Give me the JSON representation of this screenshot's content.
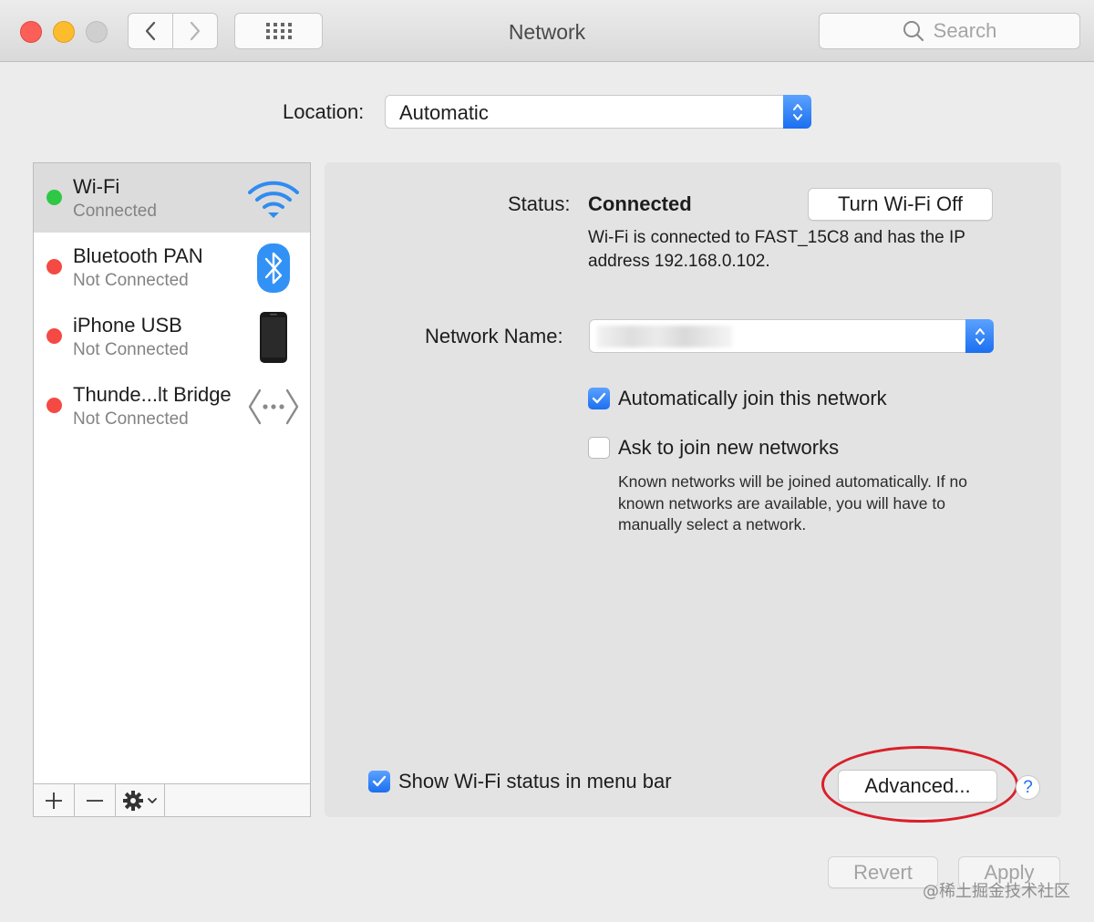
{
  "window": {
    "title": "Network",
    "search_placeholder": "Search"
  },
  "location": {
    "label": "Location:",
    "value": "Automatic"
  },
  "services": [
    {
      "name": "Wi-Fi",
      "status": "Connected",
      "state": "green",
      "icon": "wifi-icon",
      "selected": true
    },
    {
      "name": "Bluetooth PAN",
      "status": "Not Connected",
      "state": "red",
      "icon": "bluetooth-icon"
    },
    {
      "name": "iPhone USB",
      "status": "Not Connected",
      "state": "red",
      "icon": "iphone-icon"
    },
    {
      "name": "Thunde...lt Bridge",
      "status": "Not Connected",
      "state": "red",
      "icon": "thunderbolt-bridge-icon"
    }
  ],
  "sidebar_toolbar": {
    "add": "+",
    "remove": "−"
  },
  "detail": {
    "status_label": "Status:",
    "status_value": "Connected",
    "toggle_button": "Turn Wi-Fi Off",
    "status_desc": "Wi-Fi is connected to FAST_15C8 and has the IP address 192.168.0.102.",
    "network_name_label": "Network Name:",
    "auto_join_label": "Automatically join this network",
    "auto_join_checked": true,
    "ask_join_label": "Ask to join new networks",
    "ask_join_checked": false,
    "help_text": "Known networks will be joined automatically. If no known networks are available, you will have to manually select a network.",
    "show_status_label": "Show Wi-Fi status in menu bar",
    "show_status_checked": true,
    "advanced_button": "Advanced...",
    "help_button": "?"
  },
  "footer": {
    "revert": "Revert",
    "apply": "Apply",
    "watermark": "@稀土掘金技术社区"
  },
  "colors": {
    "accent": "#1b6ff0",
    "connected": "#2fc845",
    "disconnected": "#f44a43",
    "highlight": "#d9202b"
  }
}
